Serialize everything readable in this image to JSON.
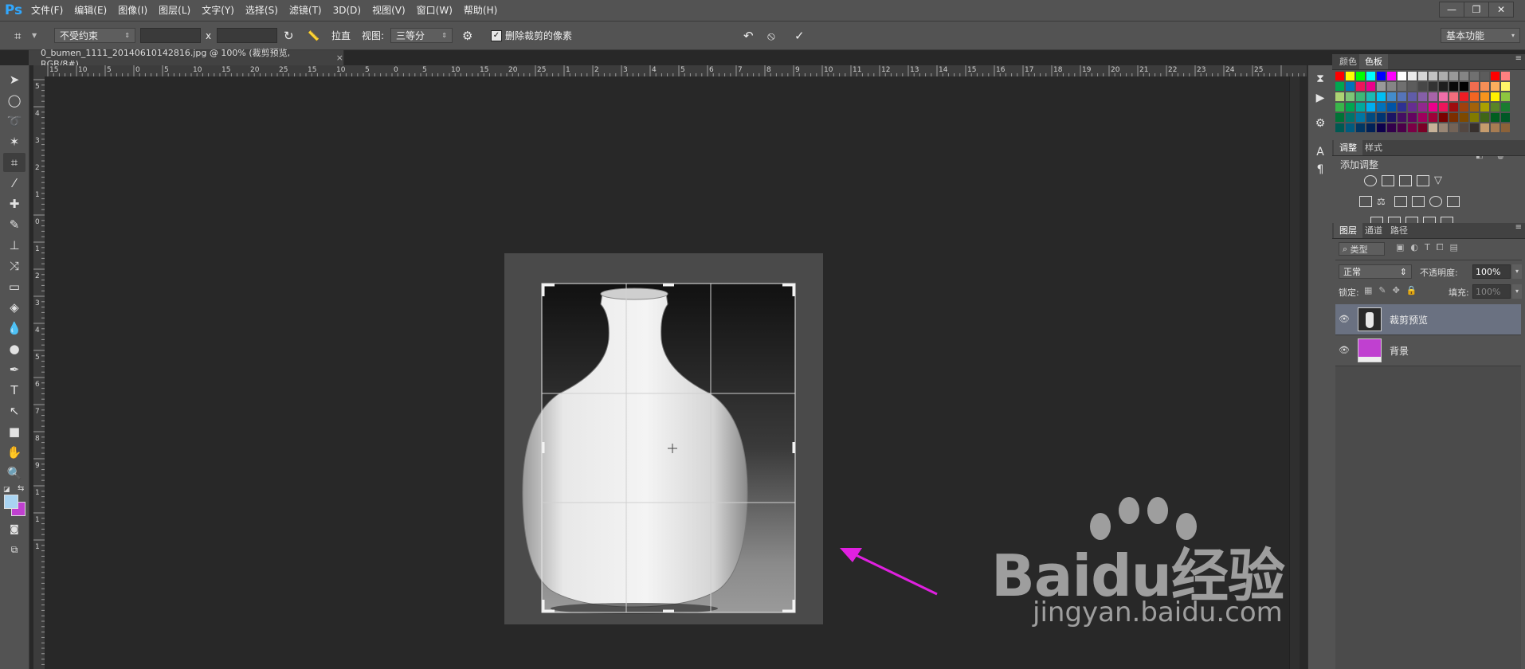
{
  "app": {
    "logo": "Ps",
    "menu": [
      "文件(F)",
      "编辑(E)",
      "图像(I)",
      "图层(L)",
      "文字(Y)",
      "选择(S)",
      "滤镜(T)",
      "3D(D)",
      "视图(V)",
      "窗口(W)",
      "帮助(H)"
    ],
    "window_controls": [
      "minimize-icon",
      "restore-icon",
      "close-icon"
    ]
  },
  "options": {
    "ratio_preset": "不受约束",
    "x_sep": "x",
    "straighten_label": "拉直",
    "view_label": "视图:",
    "view_value": "三等分",
    "delete_cropped_label": "删除裁剪的像素",
    "delete_cropped_checked": true,
    "workspace": "基本功能"
  },
  "document": {
    "tab_title": "0_bumen_1111_20140610142816.jpg @ 100% (裁剪预览, RGB/8#)",
    "tab_close": "×"
  },
  "rulers": {
    "h_labels": [
      "15",
      "10",
      "5",
      "0",
      "5",
      "10",
      "15",
      "20",
      "25",
      "15",
      "10",
      "5",
      "0",
      "5",
      "10",
      "15",
      "20",
      "25",
      "1",
      "2",
      "3",
      "4",
      "5",
      "6",
      "7",
      "8",
      "9",
      "10",
      "11",
      "12",
      "13",
      "14",
      "15",
      "16",
      "17",
      "18",
      "19",
      "20",
      "21",
      "22",
      "23",
      "24",
      "25"
    ],
    "v_labels": [
      "5",
      "4",
      "3",
      "2",
      "1",
      "0",
      "1",
      "2",
      "3",
      "4",
      "5",
      "6",
      "7",
      "8",
      "9",
      "1",
      "1",
      "1"
    ]
  },
  "panels": {
    "swatches_tabs": [
      "颜色",
      "色板"
    ],
    "adjust_tabs": [
      "调整",
      "样式"
    ],
    "adjust_title": "添加调整",
    "layers_tabs": [
      "图层",
      "通道",
      "路径"
    ],
    "filter_kind": "类型",
    "blend_mode": "正常",
    "opacity_label": "不透明度:",
    "opacity_value": "100%",
    "lock_label": "锁定:",
    "fill_label": "填充:",
    "fill_value": "100%",
    "layers": [
      {
        "name": "裁剪预览",
        "selected": true
      },
      {
        "name": "背景",
        "selected": false
      }
    ]
  },
  "watermark": {
    "brand": "Baidu经验",
    "url": "jingyan.baidu.com"
  },
  "colors": {
    "accent_arrow": "#e020e0",
    "background_layer_thumb": "#c040d0",
    "ps_blue": "#31a8ff"
  }
}
